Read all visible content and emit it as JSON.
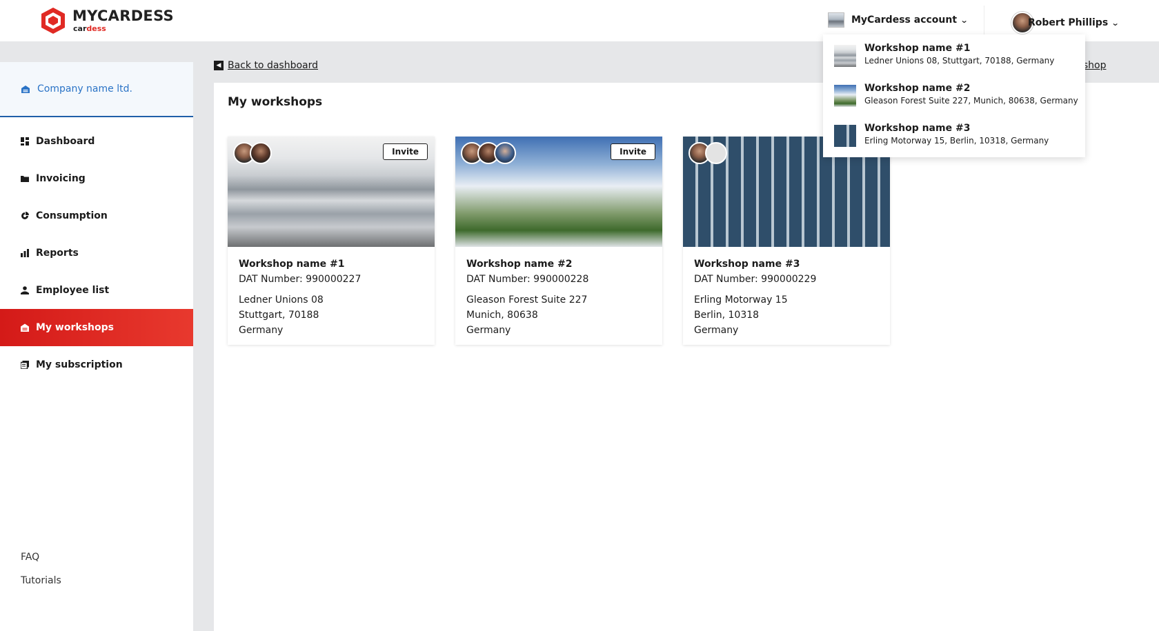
{
  "header": {
    "brand_main": "MYCARDESS",
    "brand_sub_a": "car",
    "brand_sub_b": "dess",
    "account_label": "MyCardess account",
    "user_name": "Robert Phillips"
  },
  "sidebar": {
    "company": "Company name ltd.",
    "items": [
      {
        "label": "Dashboard",
        "icon": "dashboard-icon"
      },
      {
        "label": "Invoicing",
        "icon": "folder-icon"
      },
      {
        "label": "Consumption",
        "icon": "consumption-icon"
      },
      {
        "label": "Reports",
        "icon": "bar-chart-icon"
      },
      {
        "label": "Employee list",
        "icon": "person-icon"
      },
      {
        "label": "My workshops",
        "icon": "garage-icon",
        "active": true
      },
      {
        "label": "My subscription",
        "icon": "subscription-icon"
      }
    ],
    "footer": [
      "FAQ",
      "Tutorials"
    ]
  },
  "main": {
    "back_label": "Back to dashboard",
    "add_link_partial": "rkshop",
    "title": "My workshops",
    "invite_label": "Invite",
    "cards": [
      {
        "name": "Workshop name #1",
        "dat": "DAT Number: 990000227",
        "street": "Ledner Unions 08",
        "city": "Stuttgart, 70188",
        "country": "Germany"
      },
      {
        "name": "Workshop name #2",
        "dat": "DAT Number: 990000228",
        "street": "Gleason Forest Suite 227",
        "city": "Munich, 80638",
        "country": "Germany"
      },
      {
        "name": "Workshop name #3",
        "dat": "DAT Number: 990000229",
        "street": "Erling Motorway 15",
        "city": "Berlin, 10318",
        "country": "Germany"
      }
    ]
  },
  "dropdown": {
    "items": [
      {
        "name": "Workshop name #1",
        "address": "Ledner Unions 08, Stuttgart, 70188, Germany"
      },
      {
        "name": "Workshop name #2",
        "address": "Gleason Forest Suite 227, Munich, 80638, Germany"
      },
      {
        "name": "Workshop name #3",
        "address": "Erling Motorway 15, Berlin, 10318, Germany"
      }
    ]
  },
  "colors": {
    "brand_red": "#e02a24",
    "active_nav": "#d41a18",
    "company_blue": "#2a73c6"
  }
}
